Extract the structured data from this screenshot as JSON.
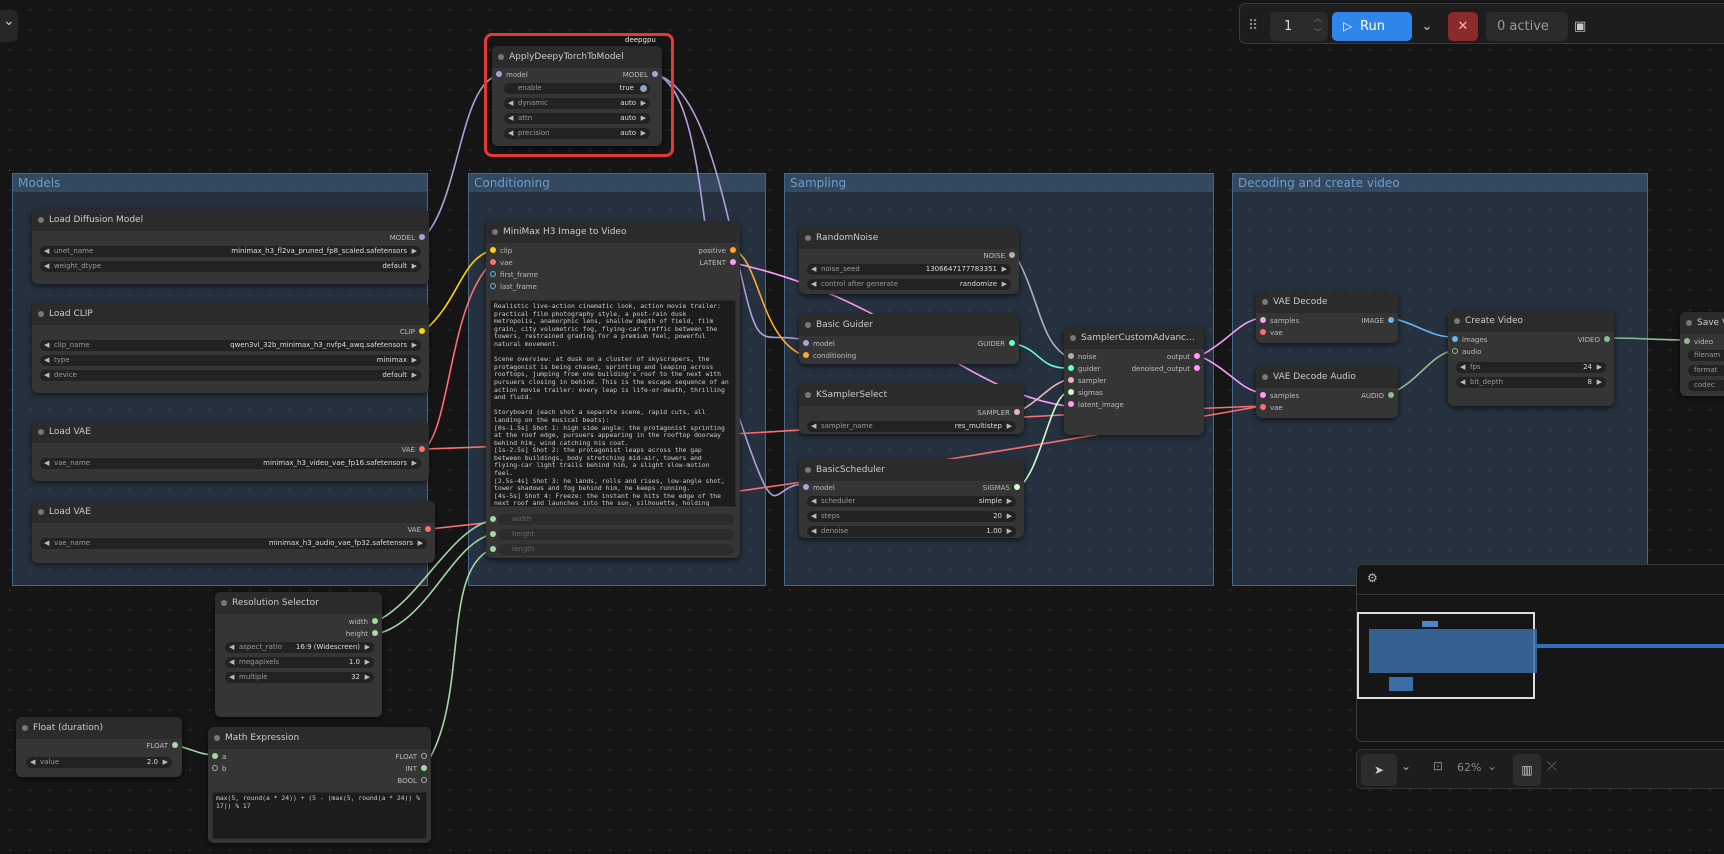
{
  "toolbar": {
    "top_left_chevron": "⌄",
    "queue_count": "1",
    "run_label": "Run",
    "active_label": "0 active"
  },
  "groups": {
    "models": "Models",
    "conditioning": "Conditioning",
    "sampling": "Sampling",
    "decoding": "Decoding and create video"
  },
  "deepy": {
    "badge": "deepgpu",
    "title": "ApplyDeepyTorchToModel",
    "input_model": "model",
    "output_model": "MODEL",
    "enable_label": "enable",
    "enable_value": "true",
    "dynamic_label": "dynamic",
    "dynamic_value": "auto",
    "attn_label": "attn",
    "attn_value": "auto",
    "precision_label": "precision",
    "precision_value": "auto"
  },
  "load_diffusion": {
    "title": "Load Diffusion Model",
    "output": "MODEL",
    "unet_label": "unet_name",
    "unet_value": "minimax_h3_fl2va_pruned_fp8_scaled.safetensors",
    "dtype_label": "weight_dtype",
    "dtype_value": "default"
  },
  "load_clip": {
    "title": "Load CLIP",
    "output": "CLIP",
    "clip_label": "clip_name",
    "clip_value": "qwen3vl_32b_minimax_h3_nvfp4_awq.safetensors",
    "type_label": "type",
    "type_value": "minimax",
    "device_label": "device",
    "device_value": "default"
  },
  "load_vae_video": {
    "title": "Load VAE",
    "output": "VAE",
    "vae_label": "vae_name",
    "vae_value": "minimax_h3_video_vae_fp16.safetensors"
  },
  "load_vae_audio": {
    "title": "Load VAE",
    "output": "VAE",
    "vae_label": "vae_name",
    "vae_value": "minimax_h3_audio_vae_fp32.safetensors"
  },
  "minimax": {
    "title": "MiniMax H3 Image to Video",
    "in_clip": "clip",
    "in_vae": "vae",
    "in_first": "first_frame",
    "in_last": "last_frame",
    "out_positive": "positive",
    "out_latent": "LATENT",
    "prompt": "Realistic live-action cinematic look, action movie trailer: practical film photography style, a post-rain dusk metropolis, anamorphic lens, shallow depth of field, film grain, city volumetric fog, flying-car traffic between the towers, restrained grading for a premium feel, powerful natural movement.\n\nScene overview: at dusk on a cluster of skyscrapers, the protagonist is being chased, sprinting and leaping across rooftops, jumping from one building's roof to the next with pursuers closing in behind. This is the escape sequence of an action movie trailer: every leap is life-or-death, thrilling and fluid.\n\nStoryboard (each shot a separate scene, rapid cuts, all landing on the musical beats):\n[0s-1.5s] Shot 1: high side angle: the protagonist sprinting at the roof edge, pursuers appearing in the rooftop doorway behind him, wind catching his coat.\n[1s-2.5s] Shot 2: the protagonist leaps across the gap between buildings, body stretching mid-air, towers and flying-car light trails behind him, a slight slow-motion feel.\n[2.5s-4s] Shot 3: he lands, rolls and rises, low-angle shot, tower shadows and fog behind him, he keeps running.\n[4s-5s] Shot 4: Freeze: the instant he hits the edge of the next roof and launches into the sun, silhouette, holding",
    "width_label": "width",
    "height_label": "height",
    "length_label": "length"
  },
  "random_noise": {
    "title": "RandomNoise",
    "output": "NOISE",
    "seed_label": "noise_seed",
    "seed_value": "1306647177783351",
    "control_label": "control after generate",
    "control_value": "randomize"
  },
  "basic_guider": {
    "title": "Basic Guider",
    "in_model": "model",
    "in_cond": "conditioning",
    "output": "GUIDER"
  },
  "ksampler_select": {
    "title": "KSamplerSelect",
    "output": "SAMPLER",
    "sampler_label": "sampler_name",
    "sampler_value": "res_multistep"
  },
  "basic_scheduler": {
    "title": "BasicScheduler",
    "in_model": "model",
    "output": "SIGMAS",
    "scheduler_label": "scheduler",
    "scheduler_value": "simple",
    "steps_label": "steps",
    "steps_value": "20",
    "denoise_label": "denoise",
    "denoise_value": "1.00"
  },
  "sampler_custom": {
    "title": "SamplerCustomAdvanc...",
    "in_noise": "noise",
    "in_guider": "guider",
    "in_sampler": "sampler",
    "in_sigmas": "sigmas",
    "in_latent": "latent_image",
    "out_output": "output",
    "out_denoised": "denoised_output"
  },
  "vae_decode": {
    "title": "VAE Decode",
    "in_samples": "samples",
    "in_vae": "vae",
    "output": "IMAGE"
  },
  "vae_decode_audio": {
    "title": "VAE Decode Audio",
    "in_samples": "samples",
    "in_vae": "vae",
    "output": "AUDIO"
  },
  "create_video": {
    "title": "Create Video",
    "in_images": "images",
    "in_audio": "audio",
    "output": "VIDEO",
    "fps_label": "fps",
    "fps_value": "24",
    "bit_label": "bit_depth",
    "bit_value": "8"
  },
  "save_video": {
    "title": "Save V",
    "in_video": "video",
    "filename_label": "filenam",
    "format_label": "format",
    "codec_label": "codec"
  },
  "resolution": {
    "title": "Resolution Selector",
    "out_width": "width",
    "out_height": "height",
    "aspect_label": "aspect_ratio",
    "aspect_value": "16:9 (Widescreen)",
    "mp_label": "megapixels",
    "mp_value": "1.0",
    "mult_label": "multiple",
    "mult_value": "32"
  },
  "float_duration": {
    "title": "Float (duration)",
    "output": "FLOAT",
    "value_label": "value",
    "value_value": "2.0"
  },
  "math_expr": {
    "title": "Math Expression",
    "in_a": "a",
    "in_b": "b",
    "out_float": "FLOAT",
    "out_int": "INT",
    "out_bool": "BOOL",
    "expression": "max(5, round(a * 24)) + (5 - (max(5, round(a * 24)) % 17)) % 17"
  },
  "zoom": {
    "value": "62%"
  }
}
